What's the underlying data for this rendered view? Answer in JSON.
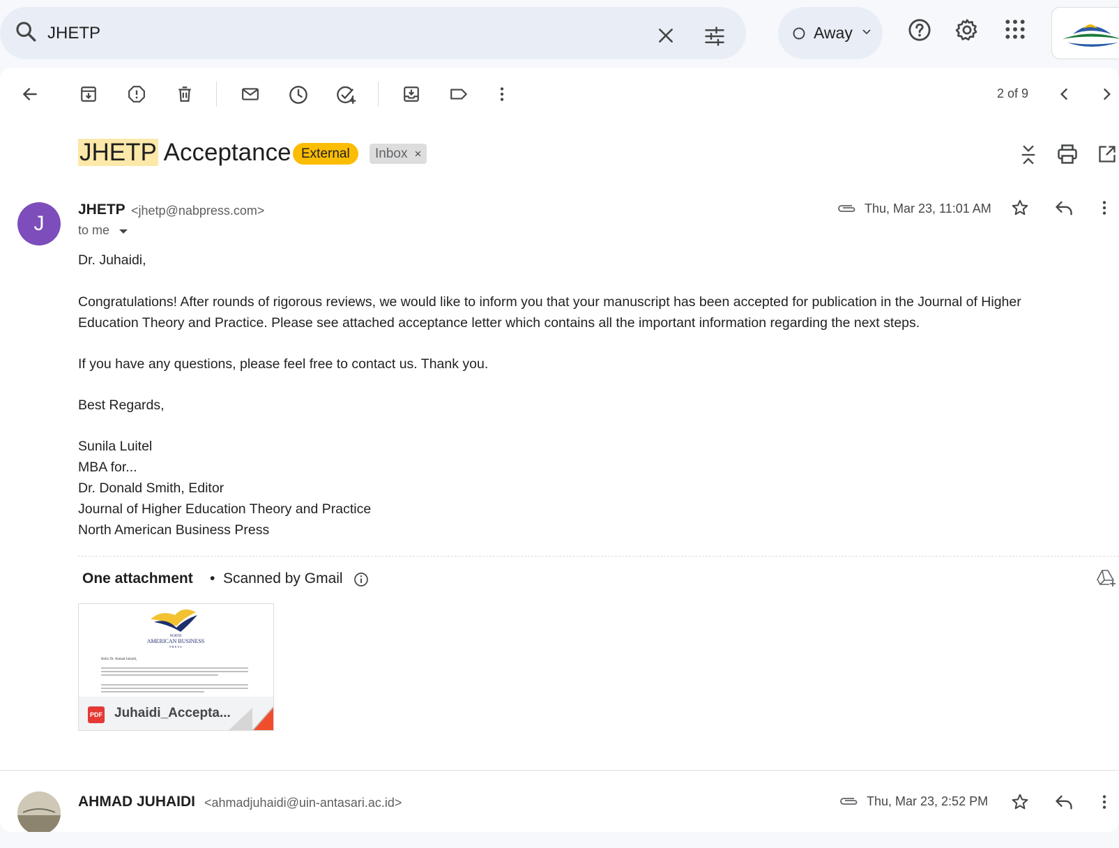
{
  "search": {
    "query": "JHETP",
    "icons": [
      "search-icon",
      "close-icon",
      "tune-icon"
    ]
  },
  "status": {
    "label": "Away"
  },
  "toolbar": {
    "icons": [
      "back-arrow-icon",
      "archive-icon",
      "report-spam-icon",
      "delete-icon",
      "mark-unread-icon",
      "snooze-icon",
      "add-task-icon",
      "move-to-icon",
      "label-icon",
      "more-vert-icon"
    ],
    "pager": "2 of 9"
  },
  "email": {
    "subject_highlight": "JHETP",
    "subject_rest": " Acceptance",
    "badge_external": "External",
    "badge_inbox": "Inbox",
    "badge_inbox_close": "×",
    "sender": {
      "initial": "J",
      "name": "JHETP",
      "email": "<jhetp@nabpress.com>",
      "to": "to me",
      "date": "Thu, Mar 23, 11:01 AM"
    },
    "body": {
      "greeting": "Dr. Juhaidi,",
      "para1_line1": "Congratulations! After rounds of rigorous reviews, we would like to inform you that your manuscript has been accepted for publication in the Journal of Higher",
      "para1_line2": "Education Theory and Practice. Please see attached acceptance letter which contains all the important information regarding the next steps.",
      "para2": "If you have any questions, please feel free to contact us. Thank you.",
      "closing": "Best Regards,",
      "sig1": "Sunila Luitel",
      "sig2": "MBA for...",
      "sig3": "Dr. Donald Smith, Editor",
      "sig4": "Journal of Higher Education Theory and Practice",
      "sig5": "North American Business Press"
    },
    "attachments": {
      "title": "One attachment",
      "separator": "•",
      "scanned": "Scanned by Gmail",
      "file_type": "PDF",
      "file_name": "Juhaidi_Accepta...",
      "preview": {
        "logo_line1": "NORTH",
        "logo_line2": "AMERICAN BUSINESS",
        "logo_line3": "P R E S S",
        "salutation": "Hello Dr. Ahmad Juhaidi,"
      }
    }
  },
  "reply": {
    "name": "AHMAD JUHAIDI",
    "email": "<ahmadjuhaidi@uin-antasari.ac.id>",
    "date": "Thu, Mar 23, 2:52 PM"
  },
  "colors": {
    "avatar_j": "#7c4dbb",
    "external_badge": "#fbbc04",
    "highlight": "#fce8a9",
    "pdf_red": "#e53935"
  }
}
